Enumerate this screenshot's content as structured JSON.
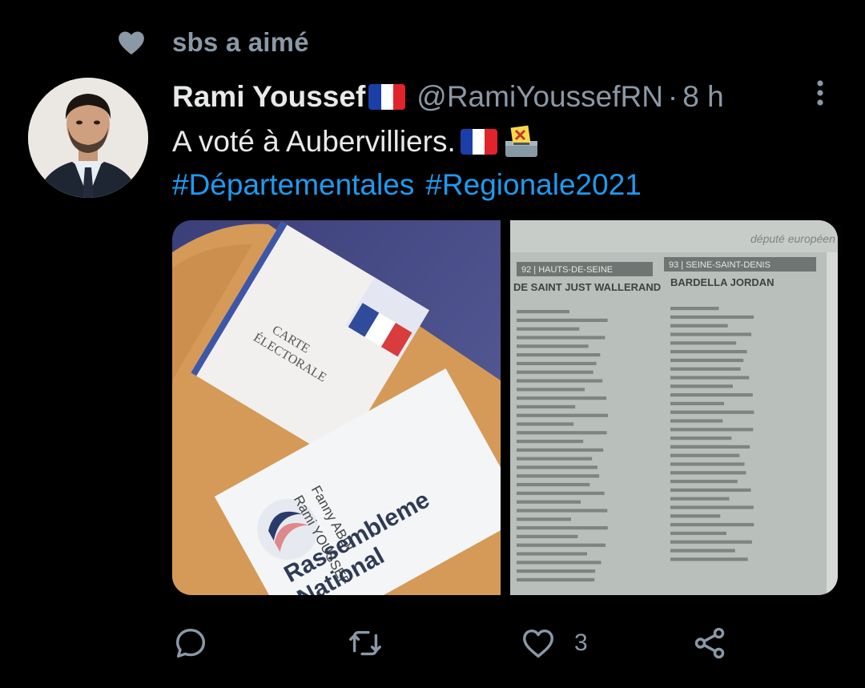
{
  "social_context": {
    "text": "sbs a aimé",
    "icon": "heart-icon"
  },
  "tweet": {
    "display_name": "Rami Youssef",
    "handle": "@RamiYoussefRN",
    "separator": "·",
    "time": "8 h",
    "text_line1": "A voté à Aubervilliers.",
    "hashtags": [
      "#Départementales",
      "#Regionale2021"
    ],
    "emoji": [
      "flag-france",
      "ballot-box"
    ],
    "media": [
      {
        "description_labels": [
          "CARTE ÉLECTORALE",
          "Fanny ABDI",
          "Rami YOUSSEF",
          "Rassemblement National"
        ]
      },
      {
        "description_labels": [
          "Député européen",
          "92 | HAUTS-DE-SEINE",
          "93 | SEINE-SAINT-DENIS",
          "DE SAINT JUST WALLERAND",
          "BARDELLA JORDAN"
        ]
      }
    ]
  },
  "actions": {
    "reply_icon": "reply-icon",
    "retweet_icon": "retweet-icon",
    "like_icon": "like-icon",
    "like_count": "3",
    "share_icon": "share-icon"
  },
  "colors": {
    "background": "#000000",
    "text_primary": "#e7e9ea",
    "text_secondary": "#8b98a5",
    "link": "#1d9bf0"
  }
}
